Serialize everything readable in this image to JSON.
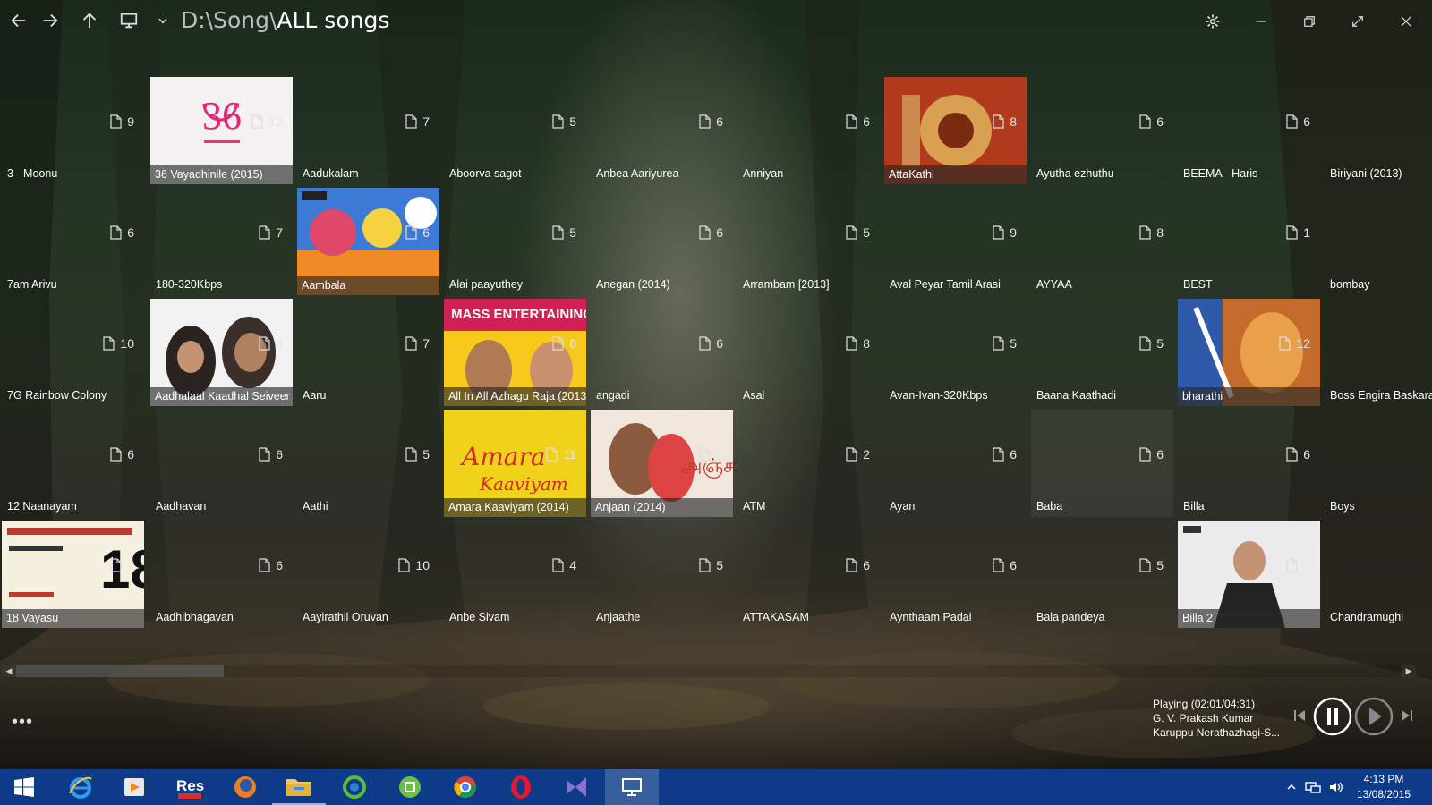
{
  "window": {
    "path_root": "D:\\Song\\",
    "path_leaf": "ALL songs"
  },
  "nav": {
    "back_icon": "arrow-left-icon",
    "forward_icon": "arrow-right-icon",
    "up_icon": "arrow-up-icon",
    "computer_icon": "monitor-icon",
    "history_icon": "chevron-down-icon"
  },
  "folders": [
    {
      "name": "3 - Moonu",
      "count": "9",
      "art": ""
    },
    {
      "name": "7am Arivu",
      "count": "6",
      "art": ""
    },
    {
      "name": "7G Rainbow Colony",
      "count": "10",
      "art": ""
    },
    {
      "name": "12 Naanayam",
      "count": "6",
      "art": ""
    },
    {
      "name": "18 Vayasu",
      "count": "7",
      "art": "vayasu"
    },
    {
      "name": "36 Vayadhinile (2015)",
      "count": "12",
      "art": "36"
    },
    {
      "name": "180-320Kbps",
      "count": "7",
      "art": ""
    },
    {
      "name": "Aadhalaal Kaadhal Seiveer",
      "count": "8",
      "art": "aadhalaal"
    },
    {
      "name": "Aadhavan",
      "count": "6",
      "art": ""
    },
    {
      "name": "Aadhibhagavan",
      "count": "6",
      "art": ""
    },
    {
      "name": "Aadukalam",
      "count": "7",
      "art": ""
    },
    {
      "name": "Aambala",
      "count": "6",
      "art": "aambala"
    },
    {
      "name": "Aaru",
      "count": "7",
      "art": ""
    },
    {
      "name": "Aathi",
      "count": "5",
      "art": ""
    },
    {
      "name": "Aayirathil Oruvan",
      "count": "10",
      "art": ""
    },
    {
      "name": "Aboorva sagot",
      "count": "5",
      "art": ""
    },
    {
      "name": "Alai paayuthey",
      "count": "5",
      "art": ""
    },
    {
      "name": "All In All Azhagu Raja (2013)",
      "count": "6",
      "art": "allinall"
    },
    {
      "name": "Amara Kaaviyam (2014)",
      "count": "11",
      "art": "amara"
    },
    {
      "name": "Anbe Sivam",
      "count": "4",
      "art": ""
    },
    {
      "name": "Anbea Aariyurea",
      "count": "6",
      "art": ""
    },
    {
      "name": "Anegan (2014)",
      "count": "6",
      "art": ""
    },
    {
      "name": "angadi",
      "count": "6",
      "art": ""
    },
    {
      "name": "Anjaan (2014)",
      "count": "8",
      "art": "anjaan"
    },
    {
      "name": "Anjaathe",
      "count": "5",
      "art": ""
    },
    {
      "name": "Anniyan",
      "count": "6",
      "art": ""
    },
    {
      "name": "Arrambam [2013]",
      "count": "5",
      "art": ""
    },
    {
      "name": "Asal",
      "count": "8",
      "art": ""
    },
    {
      "name": "ATM",
      "count": "2",
      "art": ""
    },
    {
      "name": "ATTAKASAM",
      "count": "6",
      "art": ""
    },
    {
      "name": "AttaKathi",
      "count": "8",
      "art": "attakathi"
    },
    {
      "name": "Aval Peyar Tamil Arasi",
      "count": "9",
      "art": ""
    },
    {
      "name": "Avan-Ivan-320Kbps",
      "count": "5",
      "art": ""
    },
    {
      "name": "Ayan",
      "count": "6",
      "art": ""
    },
    {
      "name": "Aynthaam Padai",
      "count": "6",
      "art": ""
    },
    {
      "name": "Ayutha ezhuthu",
      "count": "6",
      "art": ""
    },
    {
      "name": "AYYAA",
      "count": "8",
      "art": ""
    },
    {
      "name": "Baana Kaathadi",
      "count": "5",
      "art": ""
    },
    {
      "name": "Baba",
      "count": "6",
      "art": "",
      "highlight": true
    },
    {
      "name": "Bala pandeya",
      "count": "5",
      "art": ""
    },
    {
      "name": "BEEMA - Haris",
      "count": "6",
      "art": ""
    },
    {
      "name": "BEST",
      "count": "1",
      "art": ""
    },
    {
      "name": "bharathi",
      "count": "12",
      "art": "bharathi"
    },
    {
      "name": "Billa",
      "count": "6",
      "art": ""
    },
    {
      "name": "Billa 2",
      "count": "7",
      "art": "billa2"
    },
    {
      "name": "Biriyani (2013)",
      "count": "",
      "art": ""
    },
    {
      "name": "bombay",
      "count": "",
      "art": ""
    },
    {
      "name": "Boss Engira Baskaran",
      "count": "",
      "art": ""
    },
    {
      "name": "Boys",
      "count": "",
      "art": ""
    },
    {
      "name": "Chandramughi",
      "count": "",
      "art": ""
    }
  ],
  "player": {
    "status": "Playing (02:01/04:31)",
    "artist": "G. V. Prakash Kumar",
    "track": "Karuppu Nerathazhagi-S...",
    "progress_fraction": 0.446
  },
  "more_label": "•••",
  "taskbar": {
    "items": [
      "windows-logo-icon",
      "internet-explorer-icon",
      "media-player-icon",
      "res-app-icon",
      "firefox-icon",
      "file-explorer-icon",
      "sync-app-icon",
      "store-app-icon",
      "chrome-icon",
      "opera-icon",
      "visual-studio-icon",
      "this-pc-app-icon"
    ],
    "time": "4:13 PM",
    "date": "13/08/2015"
  }
}
